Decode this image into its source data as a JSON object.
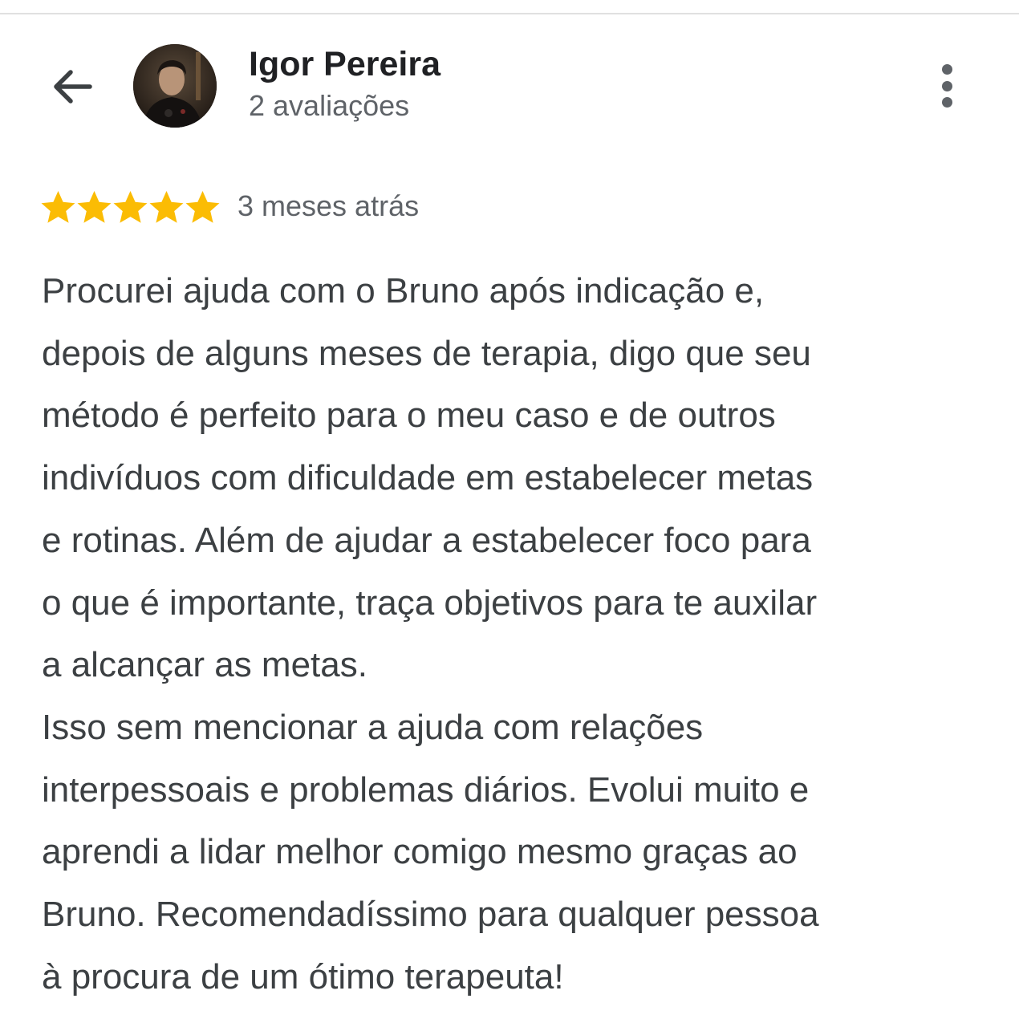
{
  "header": {
    "back_icon": "arrow-left-icon",
    "user_name": "Igor Pereira",
    "review_count": "2 avaliações",
    "more_icon": "more-vert-icon"
  },
  "review": {
    "rating": 5,
    "rating_max": 5,
    "star_color": "#fbbc04",
    "time_ago": "3 meses atrás",
    "lines": [
      "Procurei ajuda com o Bruno após indicação e,",
      "depois de alguns meses de terapia, digo que seu",
      "método é perfeito para o meu caso e de outros",
      "indivíduos com dificuldade em estabelecer metas",
      "e rotinas. Além de ajudar a estabelecer foco para",
      "o que é importante, traça objetivos para te auxilar",
      "a alcançar as metas.",
      "Isso sem mencionar a ajuda com relações",
      "interpessoais e problemas diários. Evolui muito e",
      "aprendi a lidar melhor comigo mesmo graças ao",
      "Bruno. Recomendadíssimo para qualquer pessoa",
      "à procura de um ótimo terapeuta!"
    ]
  }
}
